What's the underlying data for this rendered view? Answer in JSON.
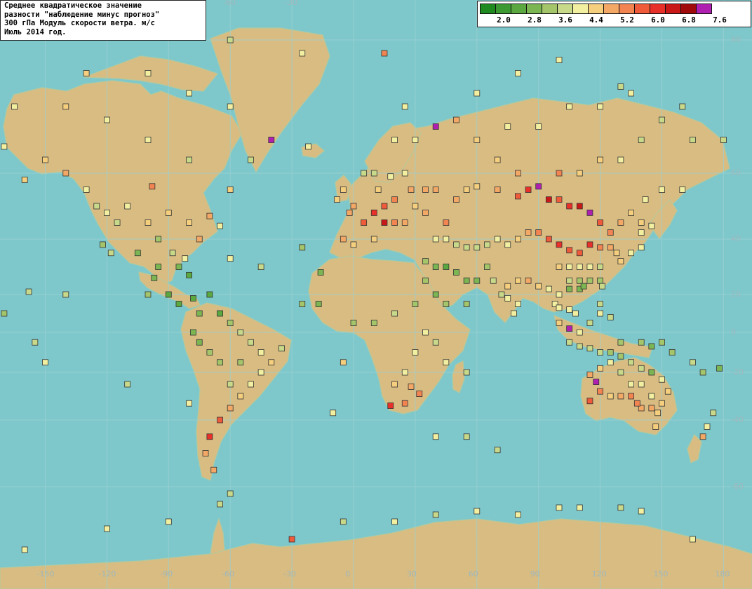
{
  "title_lines": [
    "Среднее квадратическое значение",
    "разности \"наблюдение минус прогноз\"",
    "300 гПа Модуль скорости ветра. м/с",
    "Июль 2014 год."
  ],
  "legend": {
    "colors": [
      "#1f8a1f",
      "#3d9a33",
      "#5aa83f",
      "#7cb653",
      "#a4c56a",
      "#c9d98a",
      "#f2f0a0",
      "#f5cf7e",
      "#f4a866",
      "#f28452",
      "#ef5a3a",
      "#e8302a",
      "#c81818",
      "#a00a0a",
      "#b020b0"
    ],
    "labels": [
      "2.0",
      "2.8",
      "3.6",
      "4.4",
      "5.2",
      "6.0",
      "6.8",
      "7.6"
    ]
  },
  "axes": {
    "lat_labels": [
      "80",
      "60",
      "40",
      "20",
      "0",
      "-20",
      "-40",
      "-60"
    ],
    "lon_labels": [
      "-150",
      "-120",
      "-90",
      "-60",
      "-30",
      "0",
      "30",
      "60",
      "90",
      "120",
      "150",
      "180"
    ],
    "top_lon_labels": [
      "-60",
      "-30"
    ]
  },
  "stations": {
    "value_unit": "m/s",
    "list": [
      [
        -98,
        56,
        5.8
      ],
      [
        -110,
        50,
        4.4
      ],
      [
        -100,
        45,
        4.8
      ],
      [
        -95,
        40,
        3.8
      ],
      [
        -88,
        35,
        4.1
      ],
      [
        -82,
        33,
        4.5
      ],
      [
        -75,
        40,
        5.3
      ],
      [
        -80,
        45,
        5.0
      ],
      [
        -70,
        47,
        5.5
      ],
      [
        -90,
        48,
        4.8
      ],
      [
        -105,
        35,
        3.4
      ],
      [
        -118,
        35,
        4.0
      ],
      [
        -122,
        38,
        3.7
      ],
      [
        -115,
        45,
        4.2
      ],
      [
        -120,
        48,
        4.6
      ],
      [
        -95,
        30,
        3.5
      ],
      [
        -85,
        30,
        3.2
      ],
      [
        -80,
        27,
        3.0
      ],
      [
        -97,
        26,
        3.3
      ],
      [
        -100,
        20,
        3.6
      ],
      [
        -90,
        20,
        3.1
      ],
      [
        -85,
        15,
        2.8
      ],
      [
        -78,
        18,
        3.0
      ],
      [
        -70,
        20,
        2.9
      ],
      [
        -75,
        10,
        3.2
      ],
      [
        -65,
        10,
        3.0
      ],
      [
        -60,
        5,
        3.8
      ],
      [
        -55,
        0,
        4.0
      ],
      [
        -50,
        -5,
        4.2
      ],
      [
        -45,
        -10,
        4.4
      ],
      [
        -40,
        -15,
        4.8
      ],
      [
        -45,
        -20,
        4.7
      ],
      [
        -50,
        -25,
        4.6
      ],
      [
        -55,
        -30,
        5.0
      ],
      [
        -60,
        -35,
        5.4
      ],
      [
        -65,
        -40,
        6.0
      ],
      [
        -70,
        -45,
        6.4
      ],
      [
        -72,
        -50,
        5.5
      ],
      [
        -68,
        -55,
        5.2
      ],
      [
        -60,
        -25,
        4.0
      ],
      [
        -65,
        -15,
        3.6
      ],
      [
        -70,
        -10,
        3.8
      ],
      [
        -75,
        -5,
        3.4
      ],
      [
        -78,
        0,
        3.2
      ],
      [
        -55,
        -15,
        3.9
      ],
      [
        -150,
        62,
        5.0
      ],
      [
        -160,
        58,
        4.9
      ],
      [
        -140,
        60,
        5.2
      ],
      [
        -130,
        55,
        4.5
      ],
      [
        -125,
        50,
        4.3
      ],
      [
        -140,
        70,
        4.8
      ],
      [
        -120,
        68,
        4.7
      ],
      [
        -100,
        65,
        4.5
      ],
      [
        -80,
        62,
        4.3
      ],
      [
        -60,
        55,
        4.9
      ],
      [
        -50,
        62,
        4.2
      ],
      [
        -40,
        65,
        7.8
      ],
      [
        -22,
        64,
        4.6
      ],
      [
        -25,
        37,
        3.6
      ],
      [
        -16,
        28,
        3.4
      ],
      [
        -17,
        15,
        3.3
      ],
      [
        0,
        5,
        3.8
      ],
      [
        10,
        5,
        3.6
      ],
      [
        20,
        10,
        4.0
      ],
      [
        30,
        15,
        3.7
      ],
      [
        35,
        0,
        4.4
      ],
      [
        40,
        -5,
        4.2
      ],
      [
        30,
        -10,
        4.5
      ],
      [
        25,
        -20,
        4.6
      ],
      [
        20,
        -25,
        5.0
      ],
      [
        28,
        -26,
        5.4
      ],
      [
        18,
        -34,
        6.6
      ],
      [
        25,
        -33,
        5.9
      ],
      [
        32,
        -29,
        5.6
      ],
      [
        45,
        -15,
        4.5
      ],
      [
        55,
        -20,
        4.3
      ],
      [
        0,
        50,
        5.5
      ],
      [
        5,
        45,
        6.0
      ],
      [
        10,
        48,
        6.5
      ],
      [
        15,
        50,
        6.3
      ],
      [
        20,
        52,
        5.9
      ],
      [
        -5,
        40,
        5.2
      ],
      [
        0,
        38,
        4.8
      ],
      [
        10,
        40,
        5.1
      ],
      [
        15,
        45,
        6.8
      ],
      [
        20,
        45,
        5.6
      ],
      [
        25,
        45,
        5.4
      ],
      [
        30,
        50,
        5.0
      ],
      [
        35,
        55,
        5.2
      ],
      [
        40,
        55,
        5.4
      ],
      [
        25,
        60,
        4.5
      ],
      [
        30,
        65,
        4.6
      ],
      [
        20,
        65,
        4.4
      ],
      [
        10,
        60,
        4.3
      ],
      [
        5,
        60,
        4.2
      ],
      [
        -5,
        55,
        4.8
      ],
      [
        -8,
        52,
        5.0
      ],
      [
        -2,
        48,
        5.4
      ],
      [
        12,
        55,
        5.1
      ],
      [
        18,
        59,
        4.7
      ],
      [
        28,
        55,
        5.3
      ],
      [
        35,
        48,
        5.5
      ],
      [
        45,
        45,
        5.8
      ],
      [
        50,
        52,
        5.2
      ],
      [
        55,
        55,
        5.0
      ],
      [
        60,
        56,
        4.9
      ],
      [
        70,
        55,
        5.5
      ],
      [
        80,
        53,
        6.2
      ],
      [
        85,
        55,
        6.5
      ],
      [
        90,
        56,
        7.8
      ],
      [
        95,
        52,
        6.9
      ],
      [
        100,
        52,
        6.0
      ],
      [
        105,
        50,
        6.6
      ],
      [
        110,
        50,
        7.0
      ],
      [
        115,
        48,
        7.8
      ],
      [
        120,
        45,
        6.2
      ],
      [
        125,
        42,
        5.8
      ],
      [
        130,
        45,
        5.2
      ],
      [
        135,
        48,
        5.0
      ],
      [
        140,
        45,
        4.8
      ],
      [
        142,
        52,
        4.6
      ],
      [
        150,
        55,
        4.5
      ],
      [
        160,
        55,
        4.4
      ],
      [
        100,
        60,
        5.6
      ],
      [
        110,
        60,
        5.1
      ],
      [
        120,
        62,
        4.9
      ],
      [
        130,
        62,
        4.6
      ],
      [
        140,
        65,
        4.3
      ],
      [
        80,
        60,
        5.3
      ],
      [
        70,
        62,
        5.0
      ],
      [
        60,
        65,
        4.8
      ],
      [
        50,
        68,
        5.5
      ],
      [
        40,
        67,
        7.8
      ],
      [
        75,
        67,
        4.6
      ],
      [
        90,
        67,
        4.7
      ],
      [
        105,
        70,
        4.4
      ],
      [
        120,
        70,
        4.5
      ],
      [
        135,
        72,
        4.4
      ],
      [
        150,
        68,
        4.2
      ],
      [
        165,
        65,
        4.3
      ],
      [
        40,
        40,
        4.6
      ],
      [
        45,
        40,
        4.4
      ],
      [
        50,
        38,
        4.2
      ],
      [
        55,
        37,
        4.0
      ],
      [
        60,
        37,
        4.1
      ],
      [
        65,
        38,
        4.3
      ],
      [
        70,
        40,
        4.5
      ],
      [
        75,
        38,
        4.6
      ],
      [
        80,
        40,
        4.8
      ],
      [
        85,
        42,
        5.2
      ],
      [
        90,
        42,
        5.6
      ],
      [
        95,
        40,
        6.2
      ],
      [
        100,
        38,
        6.5
      ],
      [
        105,
        36,
        6.3
      ],
      [
        110,
        35,
        6.0
      ],
      [
        115,
        38,
        6.4
      ],
      [
        120,
        37,
        5.7
      ],
      [
        125,
        37,
        5.4
      ],
      [
        128,
        35,
        5.0
      ],
      [
        100,
        30,
        4.9
      ],
      [
        105,
        30,
        4.7
      ],
      [
        110,
        30,
        4.5
      ],
      [
        115,
        30,
        4.4
      ],
      [
        120,
        30,
        4.2
      ],
      [
        105,
        25,
        4.0
      ],
      [
        110,
        25,
        3.9
      ],
      [
        115,
        25,
        3.7
      ],
      [
        120,
        25,
        3.6
      ],
      [
        105,
        22,
        3.3
      ],
      [
        110,
        22,
        3.4
      ],
      [
        112,
        23,
        3.2
      ],
      [
        100,
        20,
        4.4
      ],
      [
        95,
        22,
        4.6
      ],
      [
        90,
        23,
        5.0
      ],
      [
        85,
        25,
        5.2
      ],
      [
        80,
        25,
        5.0
      ],
      [
        75,
        23,
        4.8
      ],
      [
        75,
        18,
        4.5
      ],
      [
        80,
        15,
        4.6
      ],
      [
        78,
        10,
        4.4
      ],
      [
        72,
        20,
        4.3
      ],
      [
        68,
        25,
        4.2
      ],
      [
        65,
        30,
        3.7
      ],
      [
        60,
        25,
        3.5
      ],
      [
        55,
        25,
        3.2
      ],
      [
        50,
        28,
        3.4
      ],
      [
        45,
        30,
        3.1
      ],
      [
        40,
        30,
        3.3
      ],
      [
        35,
        32,
        3.6
      ],
      [
        35,
        25,
        3.9
      ],
      [
        40,
        20,
        3.5
      ],
      [
        45,
        15,
        3.8
      ],
      [
        55,
        15,
        3.9
      ],
      [
        98,
        15,
        4.6
      ],
      [
        100,
        13,
        4.5
      ],
      [
        105,
        12,
        4.4
      ],
      [
        108,
        10,
        4.7
      ],
      [
        100,
        5,
        5.0
      ],
      [
        105,
        2,
        7.8
      ],
      [
        110,
        0,
        4.5
      ],
      [
        115,
        5,
        4.3
      ],
      [
        120,
        10,
        4.4
      ],
      [
        125,
        8,
        4.2
      ],
      [
        120,
        15,
        4.3
      ],
      [
        121,
        23,
        4.1
      ],
      [
        130,
        32,
        4.8
      ],
      [
        135,
        35,
        4.6
      ],
      [
        140,
        37,
        4.5
      ],
      [
        140,
        42,
        4.6
      ],
      [
        145,
        44,
        4.7
      ],
      [
        105,
        -5,
        4.2
      ],
      [
        110,
        -7,
        4.0
      ],
      [
        115,
        -8,
        4.1
      ],
      [
        120,
        -10,
        4.2
      ],
      [
        125,
        -10,
        3.8
      ],
      [
        130,
        -5,
        3.9
      ],
      [
        140,
        -5,
        3.7
      ],
      [
        145,
        -7,
        3.5
      ],
      [
        150,
        -5,
        3.6
      ],
      [
        155,
        -10,
        3.8
      ],
      [
        130,
        -12,
        3.9
      ],
      [
        135,
        -15,
        4.0
      ],
      [
        140,
        -18,
        4.2
      ],
      [
        145,
        -20,
        3.5
      ],
      [
        150,
        -23,
        4.6
      ],
      [
        153,
        -28,
        4.8
      ],
      [
        150,
        -33,
        5.0
      ],
      [
        145,
        -35,
        5.2
      ],
      [
        140,
        -35,
        5.4
      ],
      [
        138,
        -33,
        5.6
      ],
      [
        135,
        -30,
        5.8
      ],
      [
        130,
        -30,
        5.3
      ],
      [
        125,
        -30,
        4.9
      ],
      [
        120,
        -28,
        5.6
      ],
      [
        115,
        -32,
        6.0
      ],
      [
        118,
        -24,
        7.8
      ],
      [
        115,
        -21,
        5.5
      ],
      [
        120,
        -18,
        4.8
      ],
      [
        125,
        -15,
        4.4
      ],
      [
        130,
        -20,
        4.3
      ],
      [
        135,
        -25,
        4.5
      ],
      [
        140,
        -25,
        4.6
      ],
      [
        145,
        -30,
        4.7
      ],
      [
        148,
        -37,
        4.9
      ],
      [
        147,
        -42,
        5.1
      ],
      [
        175,
        -37,
        4.3
      ],
      [
        172,
        -42,
        4.6
      ],
      [
        170,
        -45,
        5.2
      ],
      [
        165,
        -15,
        4.0
      ],
      [
        170,
        -20,
        3.8
      ],
      [
        178,
        -18,
        3.5
      ],
      [
        -150,
        -15,
        4.5
      ],
      [
        -175,
        -20,
        3.4
      ],
      [
        -110,
        -25,
        4.3
      ],
      [
        -80,
        -33,
        4.4
      ],
      [
        -140,
        20,
        4.2
      ],
      [
        -158,
        21,
        4.0
      ],
      [
        -170,
        10,
        3.9
      ],
      [
        -155,
        -5,
        4.3
      ],
      [
        -5,
        -15,
        4.8
      ],
      [
        -35,
        -8,
        4.0
      ],
      [
        -25,
        15,
        3.7
      ],
      [
        -45,
        30,
        4.2
      ],
      [
        -60,
        33,
        4.4
      ],
      [
        -65,
        44,
        4.6
      ],
      [
        -25,
        78,
        4.4
      ],
      [
        -60,
        80,
        4.3
      ],
      [
        15,
        78,
        5.8
      ],
      [
        25,
        70,
        4.5
      ],
      [
        60,
        72,
        4.7
      ],
      [
        80,
        75,
        4.5
      ],
      [
        100,
        77,
        4.6
      ],
      [
        130,
        73,
        4.3
      ],
      [
        160,
        70,
        4.2
      ],
      [
        180,
        65,
        4.1
      ],
      [
        -170,
        64,
        4.5
      ],
      [
        -165,
        70,
        4.4
      ],
      [
        -130,
        75,
        4.8
      ],
      [
        -100,
        75,
        4.6
      ],
      [
        -80,
        72,
        4.5
      ],
      [
        -60,
        70,
        4.7
      ],
      [
        -5,
        -70,
        4.3
      ],
      [
        20,
        -70,
        4.5
      ],
      [
        40,
        -68,
        4.3
      ],
      [
        60,
        -67,
        4.4
      ],
      [
        80,
        -68,
        4.6
      ],
      [
        100,
        -66,
        4.5
      ],
      [
        110,
        -66,
        4.4
      ],
      [
        130,
        -66,
        4.3
      ],
      [
        140,
        -67,
        4.5
      ],
      [
        165,
        -75,
        4.7
      ],
      [
        -65,
        -65,
        4.2
      ],
      [
        -60,
        -62,
        4.0
      ],
      [
        -30,
        -75,
        6.2
      ],
      [
        -90,
        -70,
        4.5
      ],
      [
        -120,
        -72,
        4.6
      ],
      [
        -160,
        -78,
        4.4
      ],
      [
        70,
        -49,
        4.3
      ],
      [
        55,
        -45,
        4.2
      ],
      [
        40,
        -45,
        4.4
      ],
      [
        -10,
        -37,
        4.5
      ]
    ]
  }
}
